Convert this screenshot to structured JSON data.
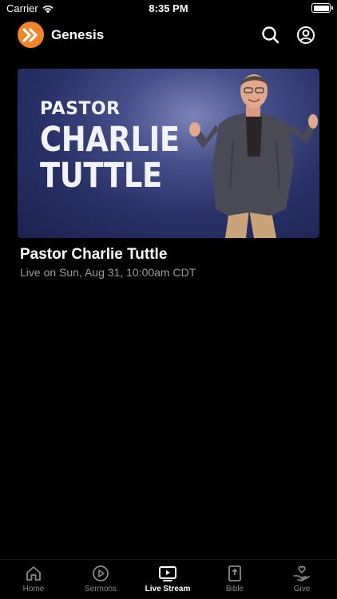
{
  "status_bar": {
    "carrier": "Carrier",
    "time": "8:35 PM"
  },
  "header": {
    "title": "Genesis"
  },
  "hero": {
    "line1": "PASTOR",
    "line2": "CHARLIE",
    "line3": "TUTTLE",
    "title": "Pastor Charlie Tuttle",
    "subtitle": "Live on Sun, Aug 31, 10:00am CDT"
  },
  "tabs": [
    {
      "label": "Home",
      "icon": "home-icon",
      "active": false
    },
    {
      "label": "Sermons",
      "icon": "play-circle-icon",
      "active": false
    },
    {
      "label": "Live Stream",
      "icon": "tv-play-icon",
      "active": true
    },
    {
      "label": "Bible",
      "icon": "bible-icon",
      "active": false
    },
    {
      "label": "Give",
      "icon": "give-icon",
      "active": false
    }
  ],
  "colors": {
    "brand": "#f4842a",
    "background": "#000000",
    "hero_blue": "#283166"
  }
}
